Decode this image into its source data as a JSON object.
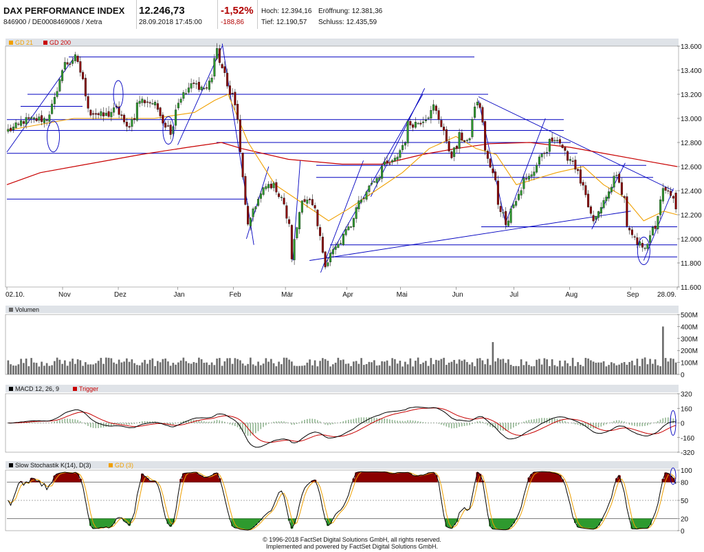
{
  "header": {
    "name": "DAX PERFORMANCE INDEX",
    "id": "846900 / DE0008469008 / Xetra",
    "price": "12.246,73",
    "datetime": "28.09.2018 17:45:00",
    "change_pct": "-1,52%",
    "change_abs": "-188,86",
    "high_label": "Hoch:",
    "high": "12.394,16",
    "low_label": "Tief:",
    "low": "12.190,57",
    "open_label": "Eröffnung:",
    "open": "12.381,36",
    "close_label": "Schluss:",
    "close": "12.435,59"
  },
  "footer": {
    "line1": "© 1996-2018 FactSet Digital Solutions GmbH, all rights reserved.",
    "line2": "Implemented and powered by FactSet Digital Solutions GmbH."
  },
  "colors": {
    "up": "#2e9a2e",
    "down": "#8b0000",
    "gd21": "#f0a000",
    "gd200": "#c80000",
    "trend": "#0000c0",
    "panel": "#dfe3e8"
  },
  "chart_data": [
    {
      "type": "candlestick",
      "legend": [
        "GD 21",
        "GD 200"
      ],
      "x_tick_labels": [
        "02.10.",
        "Nov",
        "Dez",
        "Jan",
        "Feb",
        "Mär",
        "Apr",
        "Mai",
        "Jun",
        "Jul",
        "Aug",
        "Sep",
        "28.09."
      ],
      "ylim": [
        11600,
        13600
      ],
      "y_ticks": [
        "13.600",
        "13.400",
        "13.200",
        "13.000",
        "12.800",
        "12.600",
        "12.400",
        "12.200",
        "12.000",
        "11.800",
        "11.600"
      ],
      "close_anchors": [
        [
          "02.10.2017",
          12900
        ],
        [
          "10.10.2017",
          12980
        ],
        [
          "23.10.2017",
          13000
        ],
        [
          "01.11.2017",
          13450
        ],
        [
          "07.11.2017",
          13500
        ],
        [
          "15.11.2017",
          13050
        ],
        [
          "22.11.2017",
          13020
        ],
        [
          "29.11.2017",
          13070
        ],
        [
          "05.12.2017",
          12920
        ],
        [
          "12.12.2017",
          13150
        ],
        [
          "19.12.2017",
          13130
        ],
        [
          "28.12.2017",
          12900
        ],
        [
          "03.01.2018",
          13180
        ],
        [
          "10.01.2018",
          13280
        ],
        [
          "17.01.2018",
          13250
        ],
        [
          "23.01.2018",
          13550
        ],
        [
          "26.01.2018",
          13350
        ],
        [
          "31.01.2018",
          13200
        ],
        [
          "05.02.2018",
          12700
        ],
        [
          "08.02.2018",
          12100
        ],
        [
          "12.02.2018",
          12250
        ],
        [
          "16.02.2018",
          12400
        ],
        [
          "21.02.2018",
          12450
        ],
        [
          "27.02.2018",
          12350
        ],
        [
          "05.03.2018",
          11850
        ],
        [
          "09.03.2018",
          12350
        ],
        [
          "14.03.2018",
          12300
        ],
        [
          "19.03.2018",
          12100
        ],
        [
          "22.03.2018",
          11800
        ],
        [
          "26.03.2018",
          11880
        ],
        [
          "03.04.2018",
          12050
        ],
        [
          "09.04.2018",
          12280
        ],
        [
          "16.04.2018",
          12450
        ],
        [
          "23.04.2018",
          12600
        ],
        [
          "30.04.2018",
          12650
        ],
        [
          "07.05.2018",
          12950
        ],
        [
          "14.05.2018",
          12980
        ],
        [
          "21.05.2018",
          13100
        ],
        [
          "25.05.2018",
          12900
        ],
        [
          "30.05.2018",
          12700
        ],
        [
          "04.06.2018",
          12850
        ],
        [
          "08.06.2018",
          12800
        ],
        [
          "13.06.2018",
          13150
        ],
        [
          "19.06.2018",
          12650
        ],
        [
          "25.06.2018",
          12300
        ],
        [
          "28.06.2018",
          12150
        ],
        [
          "02.07.2018",
          12250
        ],
        [
          "09.07.2018",
          12500
        ],
        [
          "13.07.2018",
          12550
        ],
        [
          "19.07.2018",
          12700
        ],
        [
          "25.07.2018",
          12850
        ],
        [
          "31.07.2018",
          12700
        ],
        [
          "06.08.2018",
          12600
        ],
        [
          "10.08.2018",
          12350
        ],
        [
          "15.08.2018",
          12150
        ],
        [
          "21.08.2018",
          12300
        ],
        [
          "27.08.2018",
          12550
        ],
        [
          "30.08.2018",
          12400
        ],
        [
          "04.09.2018",
          12050
        ],
        [
          "07.09.2018",
          11950
        ],
        [
          "12.09.2018",
          11950
        ],
        [
          "18.09.2018",
          12100
        ],
        [
          "21.09.2018",
          12400
        ],
        [
          "26.09.2018",
          12380
        ],
        [
          "28.09.2018",
          12246.73
        ]
      ],
      "gd21_anchors": [
        [
          0,
          12900
        ],
        [
          0.1,
          13000
        ],
        [
          0.16,
          13000
        ],
        [
          0.22,
          13000
        ],
        [
          0.28,
          13050
        ],
        [
          0.31,
          13150
        ],
        [
          0.33,
          13200
        ],
        [
          0.36,
          12800
        ],
        [
          0.4,
          12450
        ],
        [
          0.44,
          12300
        ],
        [
          0.48,
          12150
        ],
        [
          0.51,
          12250
        ],
        [
          0.55,
          12400
        ],
        [
          0.59,
          12550
        ],
        [
          0.63,
          12750
        ],
        [
          0.67,
          12850
        ],
        [
          0.7,
          12750
        ],
        [
          0.73,
          12700
        ],
        [
          0.76,
          12450
        ],
        [
          0.79,
          12500
        ],
        [
          0.82,
          12550
        ],
        [
          0.86,
          12600
        ],
        [
          0.89,
          12450
        ],
        [
          0.92,
          12350
        ],
        [
          0.95,
          12150
        ],
        [
          0.98,
          12230
        ],
        [
          1,
          12200
        ]
      ],
      "gd200_anchors": [
        [
          0,
          12450
        ],
        [
          0.05,
          12550
        ],
        [
          0.12,
          12620
        ],
        [
          0.2,
          12700
        ],
        [
          0.27,
          12760
        ],
        [
          0.32,
          12800
        ],
        [
          0.35,
          12750
        ],
        [
          0.42,
          12660
        ],
        [
          0.5,
          12620
        ],
        [
          0.56,
          12620
        ],
        [
          0.62,
          12700
        ],
        [
          0.67,
          12750
        ],
        [
          0.72,
          12790
        ],
        [
          0.78,
          12800
        ],
        [
          0.84,
          12760
        ],
        [
          0.9,
          12700
        ],
        [
          0.95,
          12650
        ],
        [
          1,
          12600
        ]
      ],
      "support_lines": [
        13510,
        13200,
        13100,
        12990,
        12900,
        12800,
        12710,
        12610,
        12510,
        12330,
        12100,
        11950,
        11850
      ]
    },
    {
      "type": "bar",
      "title": "Volumen",
      "ylim": [
        0,
        500
      ],
      "y_ticks": [
        "500M",
        "400M",
        "300M",
        "200M",
        "100M",
        "0"
      ],
      "typical_volume_m": 110,
      "peaks": [
        [
          "21.06.2018",
          270
        ],
        [
          "21.09.2018",
          400
        ]
      ]
    },
    {
      "type": "line",
      "title": "MACD 12, 26, 9",
      "series": [
        {
          "name": "MACD 12, 26, 9",
          "color": "#000000"
        },
        {
          "name": "Trigger",
          "color": "#c80000"
        }
      ],
      "ylim": [
        -320,
        320
      ],
      "y_ticks": [
        "320",
        "160",
        "0",
        "-160",
        "-320"
      ]
    },
    {
      "type": "line",
      "title": "Slow Stochastik K(14), D(3)",
      "series": [
        {
          "name": "Slow Stochastik K(14), D(3)",
          "color": "#000000"
        },
        {
          "name": "GD (3)",
          "color": "#f0a000"
        }
      ],
      "ylim": [
        0,
        100
      ],
      "y_ticks": [
        "100",
        "80",
        "50",
        "20",
        "0"
      ],
      "bands": [
        80,
        20
      ]
    }
  ]
}
